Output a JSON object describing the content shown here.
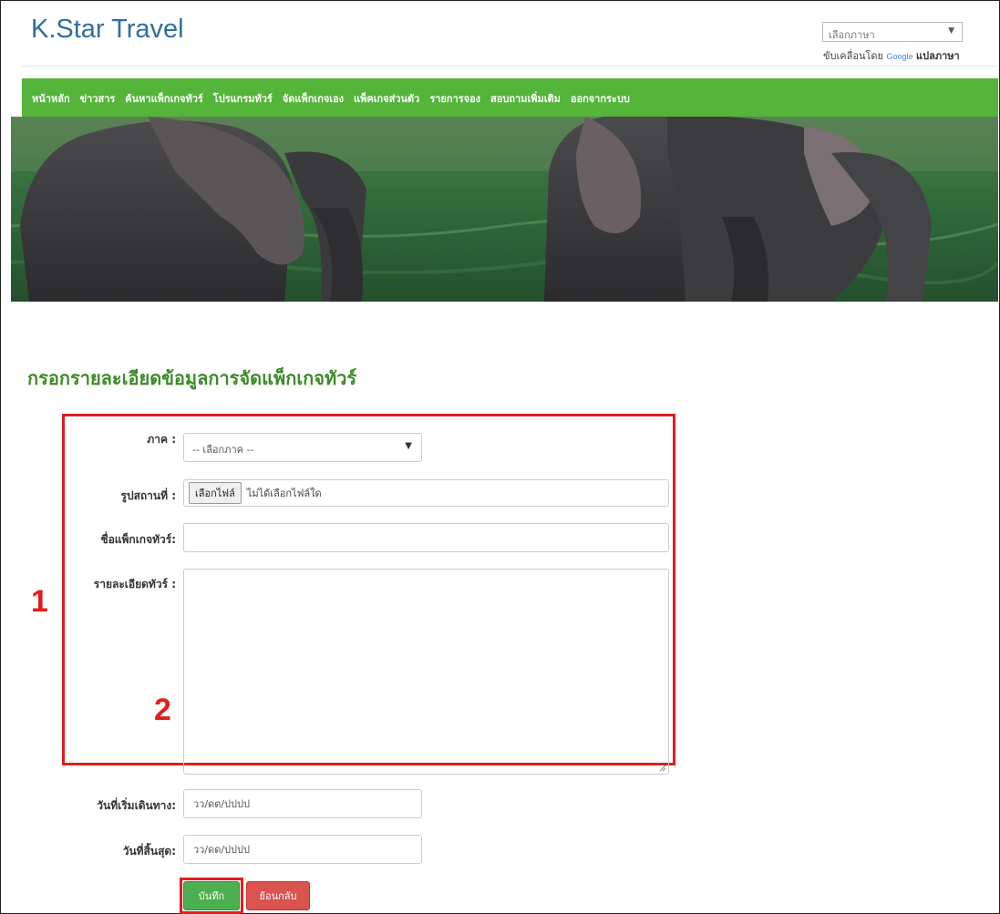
{
  "header": {
    "brand": "K.Star Travel",
    "language_select": "เลือกภาษา",
    "powered_by": "ขับเคลื่อนโดย",
    "google_word": "Google",
    "translate_word": "แปลภาษา"
  },
  "nav": {
    "items": [
      "หน้าหลัก",
      "ข่าวสาร",
      "ค้นหาแพ็กเกจทัวร์",
      "โปรแกรมทัวร์",
      "จัดแพ็กเกจเอง",
      "แพ็คเกจส่วนตัว",
      "รายการจอง",
      "สอบถามเพิ่มเติม",
      "ออกจากระบบ"
    ]
  },
  "page": {
    "title": "กรอกรายละเอียดข้อมูลการจัดแพ็กเกจทัวร์"
  },
  "form": {
    "region_label": "ภาค :",
    "region_value": "-- เลือกภาค --",
    "photo_label": "รูปสถานที่ :",
    "file_button": "เลือกไฟล์",
    "file_status": "ไม่ได้เลือกไฟล์ใด",
    "package_name_label": "ชื่อแพ็กเกจทัวร์:",
    "package_name_value": "",
    "details_label": "รายละเอียดทัวร์ :",
    "start_date_label": "วันที่เริ่มเดินทาง:",
    "start_date_placeholder": "วว/ดด/ปปปป",
    "end_date_label": "วันที่สิ้นสุด:",
    "end_date_placeholder": "วว/ดด/ปปปป"
  },
  "buttons": {
    "save": "บันทึก",
    "back": "ย้อนกลับ"
  },
  "annotations": {
    "one": "1",
    "two": "2"
  },
  "colors": {
    "nav_green": "#55b43a",
    "title_green": "#3d8b27",
    "brand_blue": "#2f6f9f",
    "highlight_red": "#e21d1d",
    "save_green": "#4caf50",
    "back_red": "#d9534f"
  }
}
